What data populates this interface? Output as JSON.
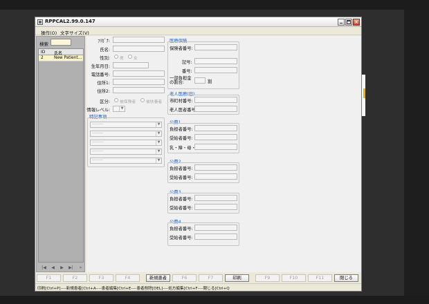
{
  "window": {
    "title": "RPPCAL2.99.0.147"
  },
  "menu": {
    "items": [
      "操作(O)",
      "文字サイズ(V)"
    ]
  },
  "search": {
    "label": "検索",
    "value": ""
  },
  "patient_list": {
    "columns": [
      "ID",
      "氏名"
    ],
    "rows": [
      {
        "id": "2",
        "name": "New Patient..."
      }
    ],
    "nav": [
      "|◀",
      "◀",
      "▶",
      "▶|",
      "»"
    ]
  },
  "patient_form": {
    "labels": {
      "kana": "ﾌﾘｶﾞﾅ:",
      "name": "氏名:",
      "sex": "性別:",
      "birth": "生年月日:",
      "phone": "電話番号:",
      "addr1": "住所1:",
      "addr2": "住所2:",
      "kubun": "区分:",
      "info_level": "情報レベル:"
    },
    "sex_options": [
      "男",
      "女"
    ],
    "kubun_options": [
      "被保険者",
      "被扶養者"
    ],
    "special_title": "特記事項",
    "special_rows": [
      "--------",
      "--------",
      "--------",
      "--------",
      "--------"
    ]
  },
  "insurance": {
    "medical": {
      "title": "医療保険",
      "insurer_no": "保険者番号:",
      "symbol": "記号:",
      "number": "番号:",
      "copay": "一部負担金の割合:",
      "copay_unit": "割"
    },
    "elderly": {
      "title": "老人医療(旧)",
      "municipality": "市町村番号:",
      "recipient": "老人医者番号:"
    },
    "public": [
      {
        "title": "公費1",
        "payer": "負担者番号:",
        "recipient": "受給者番号:",
        "extra": "乳・障・母・保:"
      },
      {
        "title": "公費2",
        "payer": "負担者番号:",
        "recipient": "受給者番号:"
      },
      {
        "title": "公費3",
        "payer": "負担者番号:",
        "recipient": "受給者番号:"
      },
      {
        "title": "公費4",
        "payer": "負担者番号:",
        "recipient": "受給者番号:"
      }
    ]
  },
  "fkeys": [
    "F1",
    "F2",
    "F3",
    "F4",
    "新規患者",
    "F6",
    "F7",
    "印刷",
    "F9",
    "F10",
    "F11",
    "閉じる"
  ],
  "status": {
    "text": "印刷[Ctrl+P]----新規患者[Ctrl+A----患者編集[Ctrl+E----患者削除[DEL]----処方編集[Ctrl+F----閉じる[Ctrl+Q"
  },
  "colors": {
    "accent": "#1f63c9",
    "list_highlight": "#fbf4c9",
    "search_bg": "#fdf6d8"
  }
}
